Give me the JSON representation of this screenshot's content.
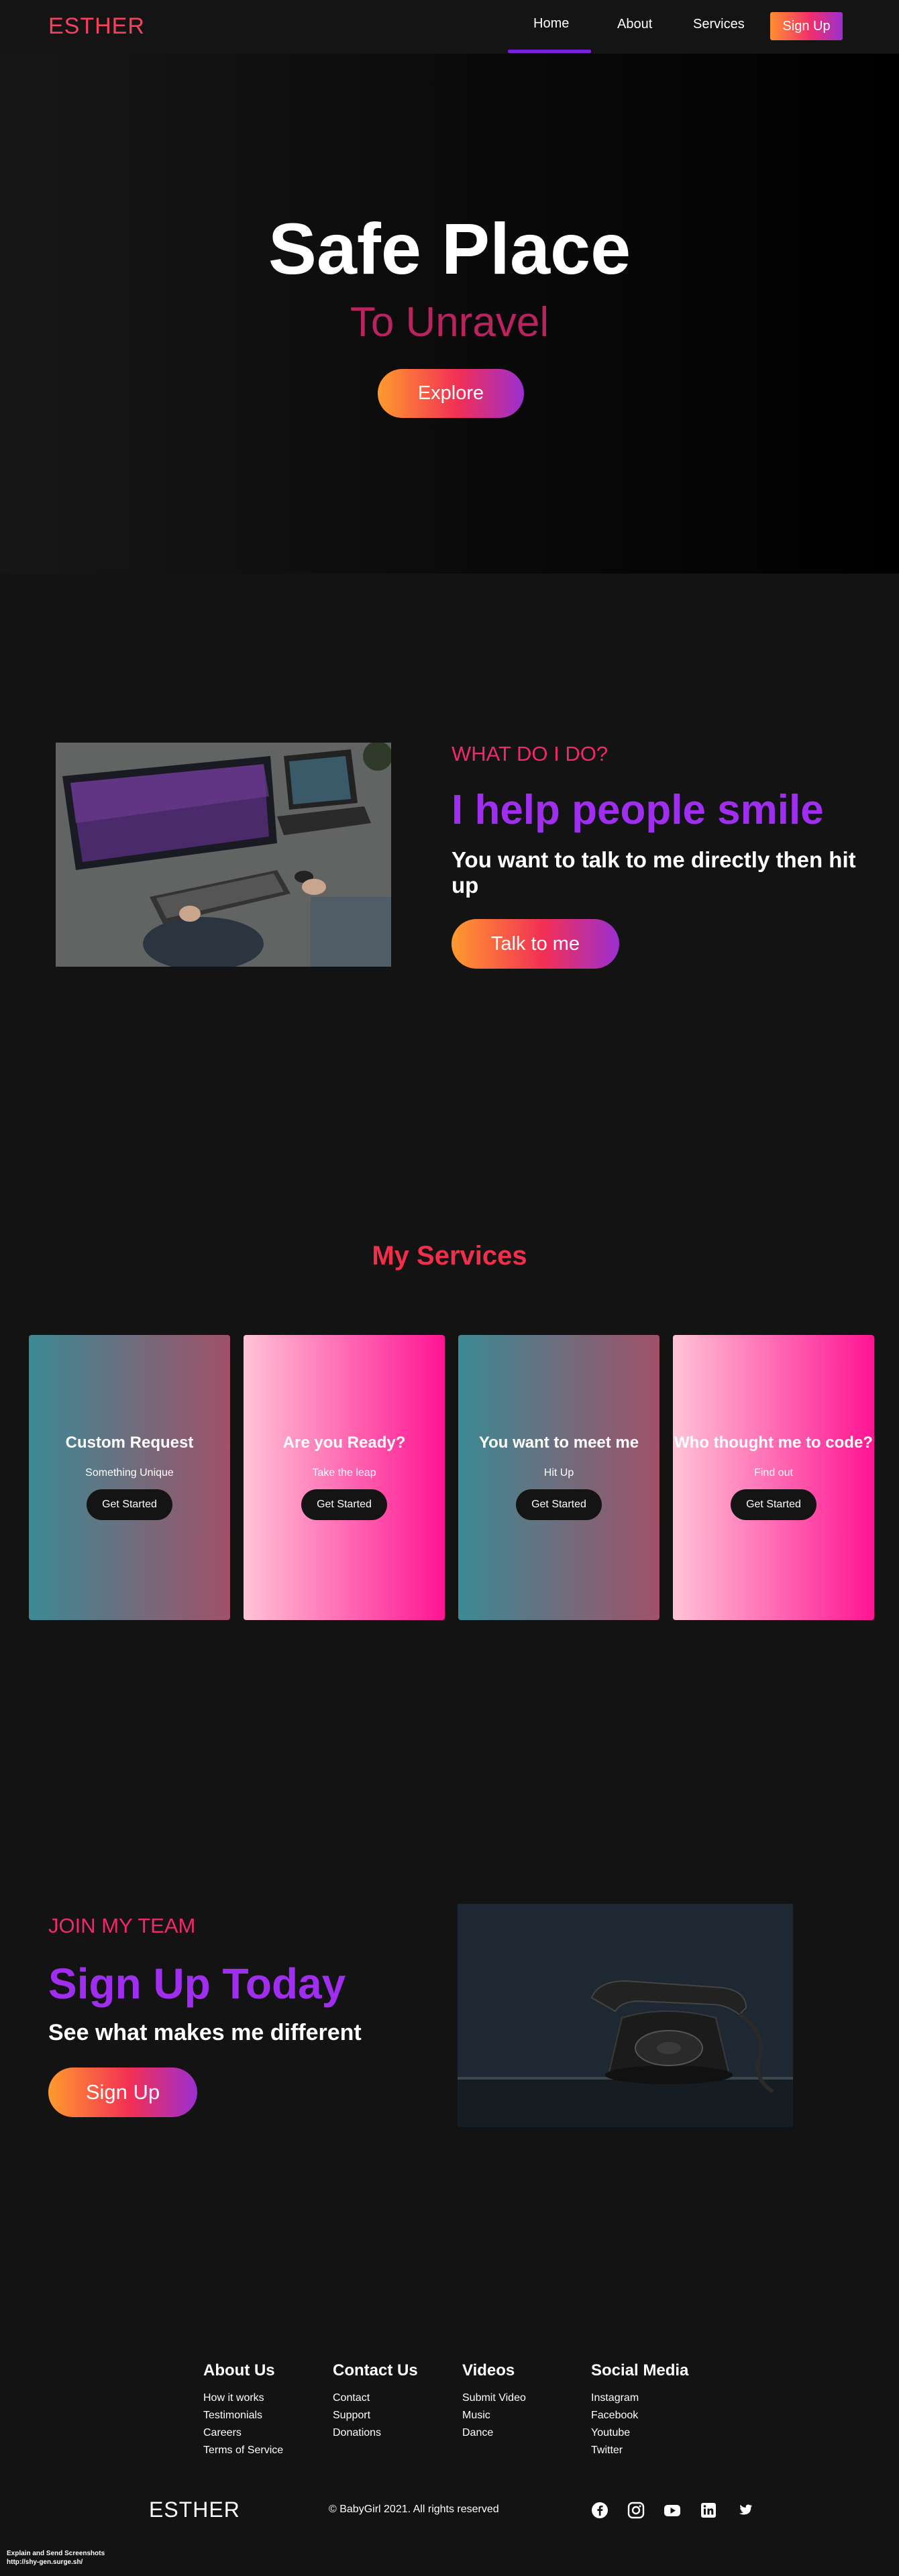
{
  "navbar": {
    "logo": "ESTHER",
    "items": [
      {
        "label": "Home",
        "active": true
      },
      {
        "label": "About",
        "active": false
      },
      {
        "label": "Services",
        "active": false
      }
    ],
    "signup_label": "Sign Up"
  },
  "hero": {
    "title": "Safe Place",
    "subtitle": "To Unravel",
    "button_label": "Explore"
  },
  "about": {
    "tag": "WHAT DO I DO?",
    "headline": "I help people smile",
    "subtext": "You want to talk to me directly then hit up",
    "button_label": "Talk to me"
  },
  "services": {
    "title": "My Services",
    "cards": [
      {
        "title": "Custom Request",
        "subtitle": "Something Unique",
        "button_label": "Get Started",
        "style": "teal"
      },
      {
        "title": "Are you Ready?",
        "subtitle": "Take the leap",
        "button_label": "Get Started",
        "style": "pink"
      },
      {
        "title": "You want to meet me",
        "subtitle": "Hit Up",
        "button_label": "Get Started",
        "style": "teal"
      },
      {
        "title": "Who thought me to code?",
        "subtitle": "Find out",
        "button_label": "Get Started",
        "style": "pink"
      }
    ]
  },
  "join": {
    "tag": "JOIN MY TEAM",
    "headline": "Sign Up Today",
    "subtext": "See what makes me different",
    "button_label": "Sign Up"
  },
  "footer": {
    "columns": [
      {
        "heading": "About Us",
        "links": [
          "How it works",
          "Testimonials",
          "Careers",
          "Terms of Service"
        ]
      },
      {
        "heading": "Contact Us",
        "links": [
          "Contact",
          "Support",
          "Donations"
        ]
      },
      {
        "heading": "Videos",
        "links": [
          "Submit Video",
          "Music",
          "Dance"
        ]
      },
      {
        "heading": "Social Media",
        "links": [
          "Instagram",
          "Facebook",
          "Youtube",
          "Twitter"
        ]
      }
    ],
    "logo": "ESTHER",
    "copyright": "© BabyGirl 2021. All rights reserved",
    "social_icons": [
      "facebook-icon",
      "instagram-icon",
      "youtube-icon",
      "linkedin-icon",
      "twitter-icon"
    ]
  },
  "bottom_note": {
    "line1": "Explain and Send Screenshots",
    "line2": "http://shy-gen.surge.sh/"
  },
  "colors": {
    "accent_red": "#f7415f",
    "accent_purple": "#a02ef0",
    "accent_pink": "#f02a6a",
    "background": "#131313"
  }
}
